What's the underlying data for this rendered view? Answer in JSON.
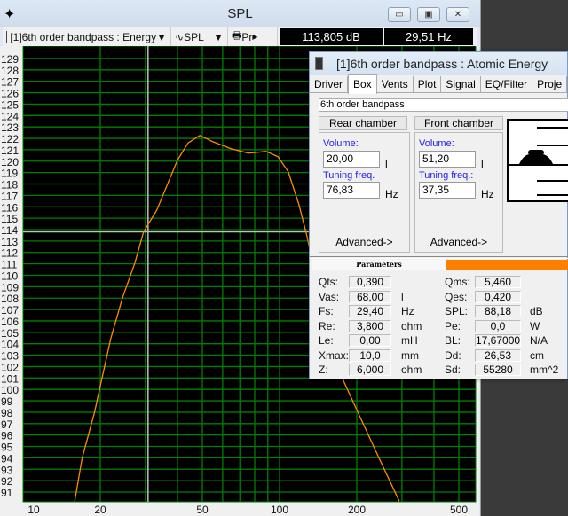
{
  "window": {
    "title": "SPL",
    "minimize": "▭",
    "maximize": "▣",
    "close": "✕"
  },
  "toolbar": {
    "project": "[1]6th order bandpass : Energy",
    "graph": "SPL",
    "print": "Pr",
    "readout_spl": "113,805 dB",
    "readout_freq": "29,51 Hz"
  },
  "dialog": {
    "title": "[1]6th order bandpass : Atomic Energy",
    "tabs": [
      "Driver",
      "Box",
      "Vents",
      "Plot",
      "Signal",
      "EQ/Filter",
      "Proje"
    ],
    "active_tab": "Box",
    "box_type": "6th order bandpass",
    "rear": {
      "button": "Rear chamber",
      "volume_label": "Volume:",
      "volume": "20,00",
      "volume_unit": "l",
      "tuning_label": "Tuning freq.",
      "tuning": "76,83",
      "tuning_unit": "Hz",
      "advanced": "Advanced->"
    },
    "front": {
      "button": "Front chamber",
      "volume_label": "Volume:",
      "volume": "51,20",
      "volume_unit": "l",
      "tuning_label": "Tuning freq.:",
      "tuning": "37,35",
      "tuning_unit": "Hz",
      "advanced": "Advanced->"
    },
    "parameters_tab": "Parameters",
    "params_left": [
      {
        "k": "Qts:",
        "v": "0,390",
        "u": ""
      },
      {
        "k": "Vas:",
        "v": "68,00",
        "u": "l"
      },
      {
        "k": "Fs:",
        "v": "29,40",
        "u": "Hz"
      },
      {
        "k": "Re:",
        "v": "3,800",
        "u": "ohm"
      },
      {
        "k": "Le:",
        "v": "0,00",
        "u": "mH"
      },
      {
        "k": "Xmax:",
        "v": "10,0",
        "u": "mm"
      },
      {
        "k": "Z:",
        "v": "6,000",
        "u": "ohm"
      }
    ],
    "params_right": [
      {
        "k": "Qms:",
        "v": "5,460",
        "u": ""
      },
      {
        "k": "Qes:",
        "v": "0,420",
        "u": ""
      },
      {
        "k": "SPL:",
        "v": "88,18",
        "u": "dB"
      },
      {
        "k": "Pe:",
        "v": "0,0",
        "u": "W"
      },
      {
        "k": "BL:",
        "v": "17,67000",
        "u": "N/A"
      },
      {
        "k": "Dd:",
        "v": "26,53",
        "u": "cm"
      },
      {
        "k": "Sd:",
        "v": "55280",
        "u": "mm^2"
      }
    ]
  },
  "chart_data": {
    "type": "line",
    "xscale": "log",
    "xlim": [
      10,
      520
    ],
    "ylim": [
      90.2,
      130
    ],
    "xticks": [
      10,
      20,
      50,
      100,
      200,
      500
    ],
    "yticks": [
      91,
      92,
      93,
      94,
      95,
      96,
      97,
      98,
      99,
      100,
      101,
      102,
      103,
      104,
      105,
      106,
      107,
      108,
      109,
      110,
      111,
      112,
      113,
      114,
      115,
      116,
      117,
      118,
      119,
      120,
      121,
      122,
      123,
      124,
      125,
      126,
      127,
      128,
      129
    ],
    "grid": true,
    "colors": {
      "background": "#000000",
      "grid": "#008000",
      "curve": "#ff8c00",
      "cursor": "#c0c0c0"
    },
    "cursor": {
      "x": 29.51,
      "y": 113.805
    },
    "x": [
      15.9,
      17,
      19,
      20,
      22,
      24.4,
      27.3,
      29.5,
      33.2,
      40,
      44,
      48.9,
      55,
      64.5,
      75.6,
      88.6,
      98.5,
      108,
      119,
      128,
      150,
      178,
      201,
      244,
      293
    ],
    "y": [
      90.2,
      94,
      98,
      100.3,
      104.5,
      108,
      111.1,
      113.8,
      115.7,
      120.1,
      121.6,
      122.26,
      121.7,
      121.1,
      120.7,
      120.85,
      120.4,
      119.1,
      116.2,
      113.4,
      106,
      100.7,
      98.1,
      94,
      90.2
    ]
  }
}
